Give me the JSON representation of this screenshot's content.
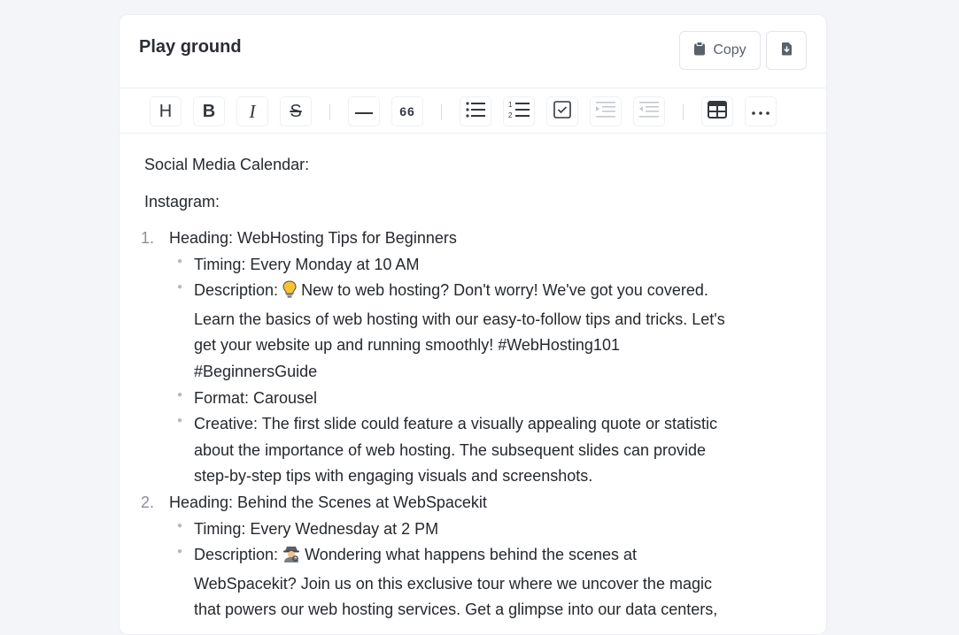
{
  "card": {
    "title": "Play ground",
    "copy_label": "Copy"
  },
  "toolbar": {
    "heading_glyph": "H",
    "bold_glyph": "B",
    "italic_glyph": "I",
    "strike_glyph": "S",
    "quote_glyph": "66"
  },
  "content": {
    "heading": "Social Media Calendar:",
    "platform": "Instagram:",
    "items": [
      {
        "number": "1.",
        "heading": "Heading: WebHosting Tips for Beginners",
        "timing": "Timing: Every Monday at 10 AM",
        "description_prefix": "Description:",
        "description_icon": "lightbulb-icon",
        "description_text": "New to web hosting? Don't worry! We've got you covered.",
        "description_line2": "Learn the basics of web hosting with our easy-to-follow tips and tricks. Let's",
        "description_line3": "get your website up and running smoothly! #WebHosting101",
        "description_line4": "#BeginnersGuide",
        "format": "Format: Carousel",
        "creative_line1": "Creative: The first slide could feature a visually appealing quote or statistic",
        "creative_line2": "about the importance of web hosting. The subsequent slides can provide",
        "creative_line3": "step-by-step tips with engaging visuals and screenshots."
      },
      {
        "number": "2.",
        "heading": "Heading: Behind the Scenes at WebSpacekit",
        "timing": "Timing: Every Wednesday at 2 PM",
        "description_prefix": "Description:",
        "description_icon": "detective-icon",
        "description_text": "Wondering what happens behind the scenes at",
        "description_line2": "WebSpacekit? Join us on this exclusive tour where we uncover the magic",
        "description_line3": "that powers our web hosting services. Get a glimpse into our data centers,"
      }
    ]
  }
}
